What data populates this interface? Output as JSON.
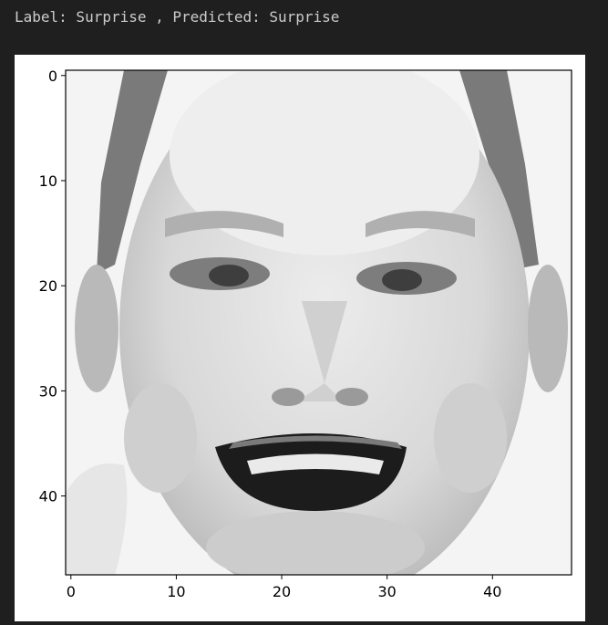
{
  "output": {
    "text": "Label: Surprise , Predicted: Surprise"
  },
  "chart_data": {
    "type": "heatmap",
    "colormap": "gray",
    "image_shape": [
      48,
      48
    ],
    "xlim": [
      -0.5,
      47.5
    ],
    "ylim": [
      47.5,
      -0.5
    ],
    "x_ticks": [
      0,
      10,
      20,
      30,
      40
    ],
    "y_ticks": [
      0,
      10,
      20,
      30,
      40
    ],
    "x_tick_labels": [
      "0",
      "10",
      "20",
      "30",
      "40"
    ],
    "y_tick_labels": [
      "0",
      "10",
      "20",
      "30",
      "40"
    ]
  }
}
